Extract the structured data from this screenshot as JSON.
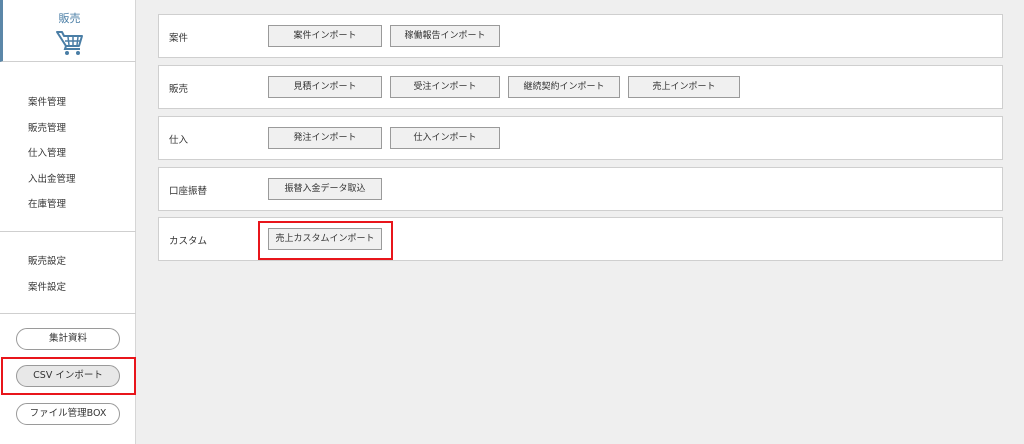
{
  "sidebar": {
    "module_title": "販売",
    "nav_main": [
      "案件管理",
      "販売管理",
      "仕入管理",
      "入出金管理",
      "在庫管理"
    ],
    "nav_settings": [
      "販売設定",
      "案件設定"
    ],
    "pills": {
      "reports": "集計資料",
      "csv_import": "CSV インポート",
      "file_box": "ファイル管理BOX"
    }
  },
  "sections": [
    {
      "label": "案件",
      "buttons": [
        "案件インポート",
        "稼働報告インポート"
      ]
    },
    {
      "label": "販売",
      "buttons": [
        "見積インポート",
        "受注インポート",
        "継続契約インポート",
        "売上インポート"
      ]
    },
    {
      "label": "仕入",
      "buttons": [
        "発注インポート",
        "仕入インポート"
      ]
    },
    {
      "label": "口座振替",
      "buttons": [
        "振替入金データ取込"
      ]
    },
    {
      "label": "カスタム",
      "buttons": [
        "売上カスタムインポート"
      ]
    }
  ],
  "colors": {
    "accent": "#4a7ea6",
    "highlight": "#e8151b"
  },
  "icons": {
    "module": "shopping-cart-icon"
  }
}
